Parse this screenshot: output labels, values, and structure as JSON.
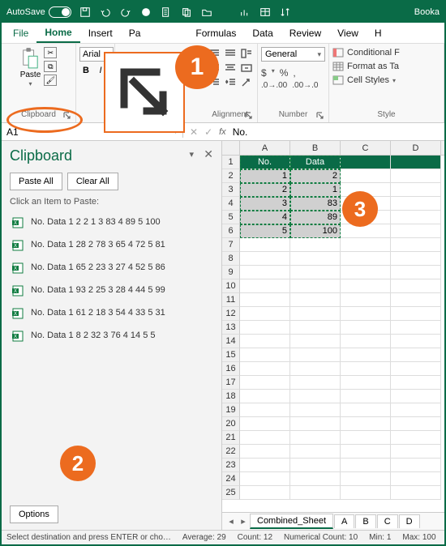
{
  "titlebar": {
    "autosave": "AutoSave",
    "docname": "Booka"
  },
  "menu": {
    "file": "File",
    "home": "Home",
    "insert": "Insert",
    "page": "Pa",
    "formulas": "Formulas",
    "data": "Data",
    "review": "Review",
    "view": "View",
    "help": "H"
  },
  "ribbon": {
    "clipboard": {
      "label": "Clipboard",
      "paste": "Paste"
    },
    "font": {
      "name": "Arial",
      "b": "B",
      "i": "I"
    },
    "alignment": {
      "label": "Alignment"
    },
    "number": {
      "label": "Number",
      "format": "General",
      "cur": "$",
      "pct": "%",
      "comma": ","
    },
    "styles": {
      "label": "Style",
      "cond": "Conditional F",
      "fmt": "Format as Ta",
      "cell": "Cell Styles"
    }
  },
  "namebox": {
    "ref": "A1",
    "formula": "No."
  },
  "clipboard_pane": {
    "title": "Clipboard",
    "paste_all": "Paste All",
    "clear_all": "Clear All",
    "hint": "Click an Item to Paste:",
    "items": [
      "No. Data 1 2 2 1 3 83 4 89 5 100",
      "No. Data 1 28 2 78 3 65 4 72 5 81",
      "No. Data 1 65 2 23 3 27 4 52 5 86",
      "No. Data 1 93 2 25 3 28 4 44 5 99",
      "No. Data 1 61 2 18 3 54 4 33 5 31",
      "No. Data 1 8 2 32 3 76 4 14 5 5"
    ],
    "options": "Options"
  },
  "grid": {
    "cols": [
      "A",
      "B",
      "C",
      "D"
    ],
    "header": [
      "No.",
      "Data"
    ],
    "rows": [
      [
        "1",
        "2"
      ],
      [
        "2",
        "1"
      ],
      [
        "3",
        "83"
      ],
      [
        "4",
        "89"
      ],
      [
        "5",
        "100"
      ]
    ],
    "blank_rows": 19
  },
  "sheets": {
    "active": "Combined_Sheet",
    "others": [
      "A",
      "B",
      "C",
      "D"
    ]
  },
  "status": {
    "msg": "Select destination and press ENTER or cho…",
    "avg": "Average: 29",
    "count": "Count: 12",
    "ncount": "Numerical Count: 10",
    "min": "Min: 1",
    "max": "Max: 100"
  },
  "callouts": {
    "c1": "1",
    "c2": "2",
    "c3": "3"
  }
}
